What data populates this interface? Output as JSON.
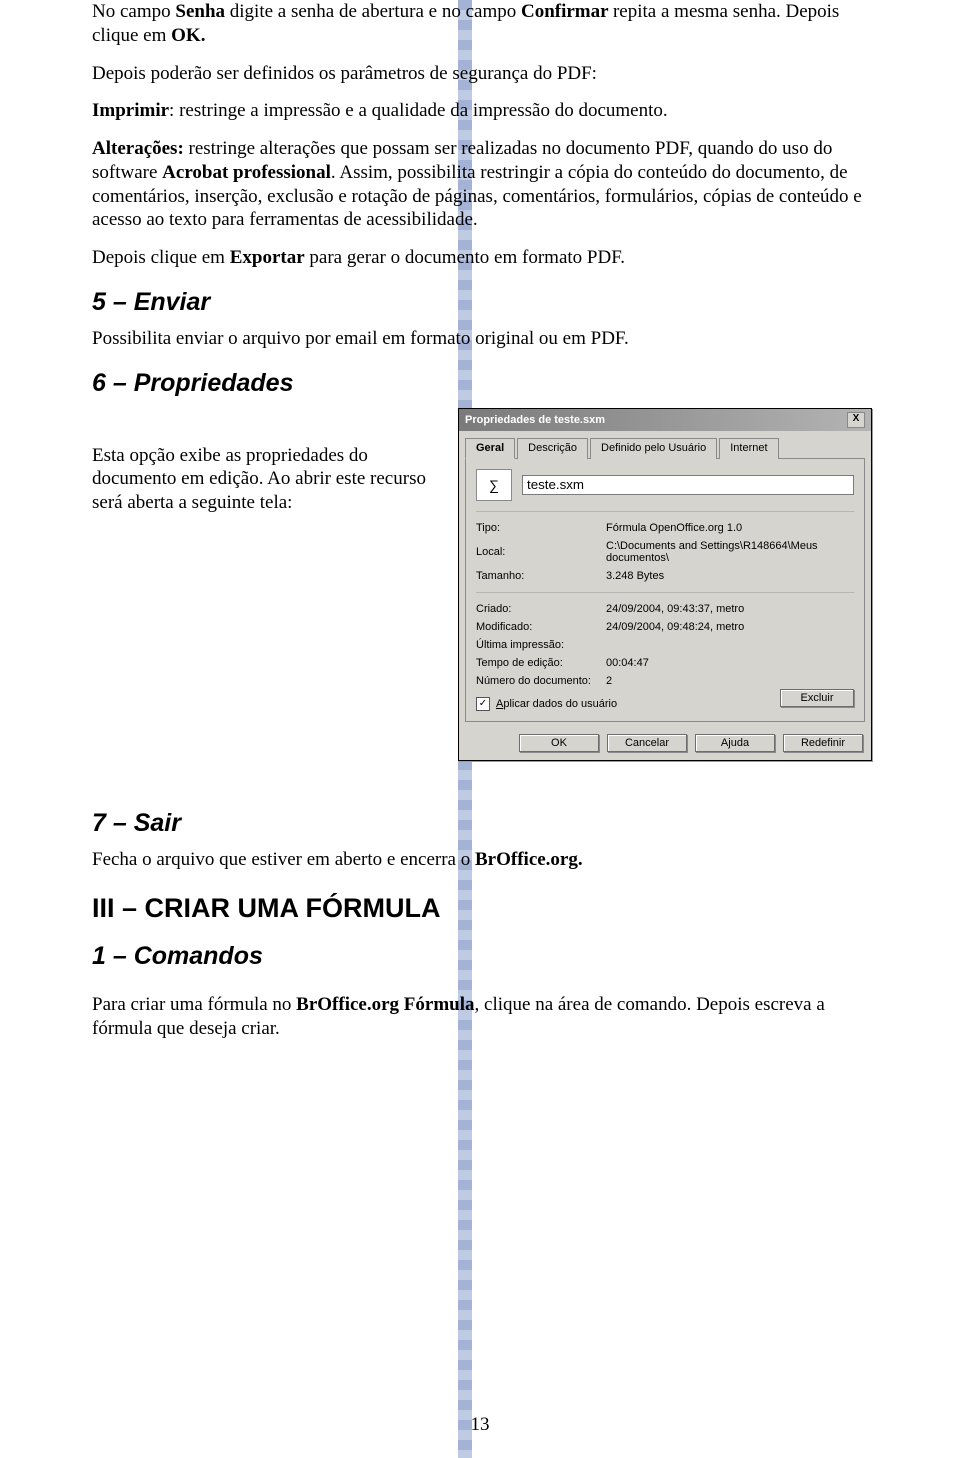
{
  "p1_a": "No campo ",
  "p1_b": "Senha ",
  "p1_c": "digite a senha de abertura e no campo ",
  "p1_d": "Confirmar ",
  "p1_e": "repita a mesma senha. Depois clique em ",
  "p1_f": "OK.",
  "p2": "Depois poderão ser definidos os parâmetros de segurança do PDF:",
  "p3_a": "Imprimir",
  "p3_b": ": restringe a impressão e a qualidade da impressão do documento.",
  "p4_a": "Alterações:",
  "p4_b": " restringe alterações que possam ser realizadas no documento PDF, quando do uso do software ",
  "p4_c": "Acrobat professional",
  "p4_d": ". Assim, possibilita restringir a cópia do conteúdo do documento, de comentários, inserção, exclusão e rotação de páginas, comentários, formulários, cópias de conteúdo e acesso ao texto para ferramentas de acessibilidade.",
  "p5_a": "Depois clique em ",
  "p5_b": "Exportar",
  "p5_c": " para gerar o documento em formato PDF.",
  "h_enviar": "5 – Enviar",
  "p_enviar": "Possibilita enviar o arquivo por email em formato original ou em PDF.",
  "h_prop": "6 – Propriedades",
  "p_prop": "Esta opção exibe as propriedades do documento em edição. Ao abrir este recurso será aberta a seguinte tela:",
  "h_sair": "7 – Sair",
  "p_sair_a": "Fecha o arquivo que estiver em aberto e encerra o ",
  "p_sair_b": "BrOffice.org.",
  "h_criar": "III – CRIAR UMA FÓRMULA",
  "h_cmd": "1 – Comandos",
  "p_cmd_a": "Para criar uma fórmula no ",
  "p_cmd_b": "BrOffice.org Fórmula",
  "p_cmd_c": ", clique na área de comando. Depois escreva a fórmula que deseja criar.",
  "pagenum": "13",
  "dialog": {
    "title": "Propriedades de teste.sxm",
    "close": "X",
    "tabs": {
      "geral": "Geral",
      "desc": "Descrição",
      "user": "Definido pelo Usuário",
      "net": "Internet"
    },
    "icon": "∑",
    "filename": "teste.sxm",
    "labels": {
      "tipo": "Tipo:",
      "local": "Local:",
      "tam": "Tamanho:",
      "criado": "Criado:",
      "mod": "Modificado:",
      "ult": "Última impressão:",
      "edicao": "Tempo de edição:",
      "num": "Número do documento:"
    },
    "values": {
      "tipo": "Fórmula OpenOffice.org 1.0",
      "local": "C:\\Documents and Settings\\R148664\\Meus documentos\\",
      "tam": "3.248 Bytes",
      "criado": "24/09/2004, 09:43:37, metro",
      "mod": "24/09/2004, 09:48:24, metro",
      "ult": "",
      "edicao": "00:04:47",
      "num": "2"
    },
    "chk_label_a": "A",
    "chk_label_b": "plicar dados do usuário",
    "btn_excluir": "Excluir",
    "btns": {
      "ok": "OK",
      "cancel": "Cancelar",
      "help": "Ajuda",
      "reset": "Redefinir"
    }
  }
}
